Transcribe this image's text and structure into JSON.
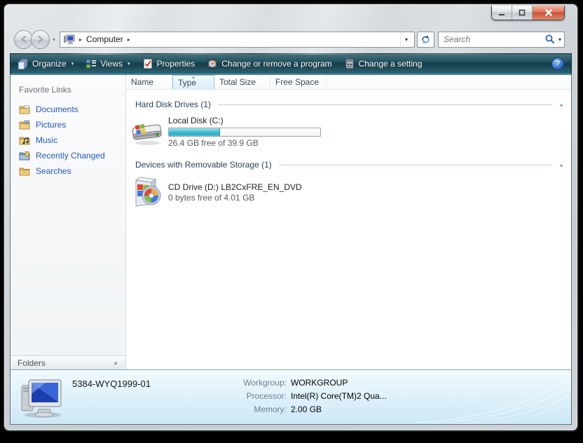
{
  "icons": {
    "breadcrumb_arrow": "▸",
    "caret_down": "▾",
    "sort_asc": "▲",
    "collapse_up": "▲",
    "help": "?"
  },
  "navbar": {
    "breadcrumb_root": "Computer",
    "search_placeholder": "Search"
  },
  "toolbar": {
    "items": [
      {
        "label": "Organize",
        "has_dropdown": true
      },
      {
        "label": "Views",
        "has_dropdown": true
      },
      {
        "label": "Properties",
        "has_dropdown": false
      },
      {
        "label": "Change or remove a program",
        "has_dropdown": false
      },
      {
        "label": "Change a setting",
        "has_dropdown": false
      }
    ]
  },
  "columns": {
    "headers": [
      {
        "label": "Name"
      },
      {
        "label": "Type"
      },
      {
        "label": "Total Size"
      },
      {
        "label": "Free Space"
      }
    ],
    "sorted_by": "Type",
    "sort_direction": "ascending"
  },
  "sidebar": {
    "title": "Favorite Links",
    "items": [
      {
        "label": "Documents"
      },
      {
        "label": "Pictures"
      },
      {
        "label": "Music"
      },
      {
        "label": "Recently Changed"
      },
      {
        "label": "Searches"
      }
    ],
    "folders_label": "Folders"
  },
  "content": {
    "groups": [
      {
        "title": "Hard Disk Drives (1)",
        "items": [
          {
            "name": "Local Disk (C:)",
            "detail": "26.4 GB free of 39.9 GB",
            "capacity_percent_used": 34,
            "bar_style": "width:34%"
          }
        ]
      },
      {
        "title": "Devices with Removable Storage (1)",
        "items": [
          {
            "name": "CD Drive (D:) LB2CxFRE_EN_DVD",
            "detail": "0 bytes free of 4.01 GB"
          }
        ]
      }
    ]
  },
  "details": {
    "computer_name": "5384-WYQ1999-01",
    "fields": [
      {
        "label": "Workgroup:",
        "value": "WORKGROUP"
      },
      {
        "label": "Processor:",
        "value": "Intel(R) Core(TM)2 Qua..."
      },
      {
        "label": "Memory:",
        "value": "2.00 GB"
      }
    ]
  },
  "colors": {
    "toolbar_teal_dark": "#143e4c",
    "toolbar_teal_light": "#45727f",
    "link_blue": "#2257c4",
    "capacity_bar_teal": "#2fa9c2",
    "details_pane_blue": "#ddf0fa",
    "close_button_red": "#cc4f30",
    "selected_column_blue": "#d9eefa",
    "group_header_text": "#24425f"
  }
}
